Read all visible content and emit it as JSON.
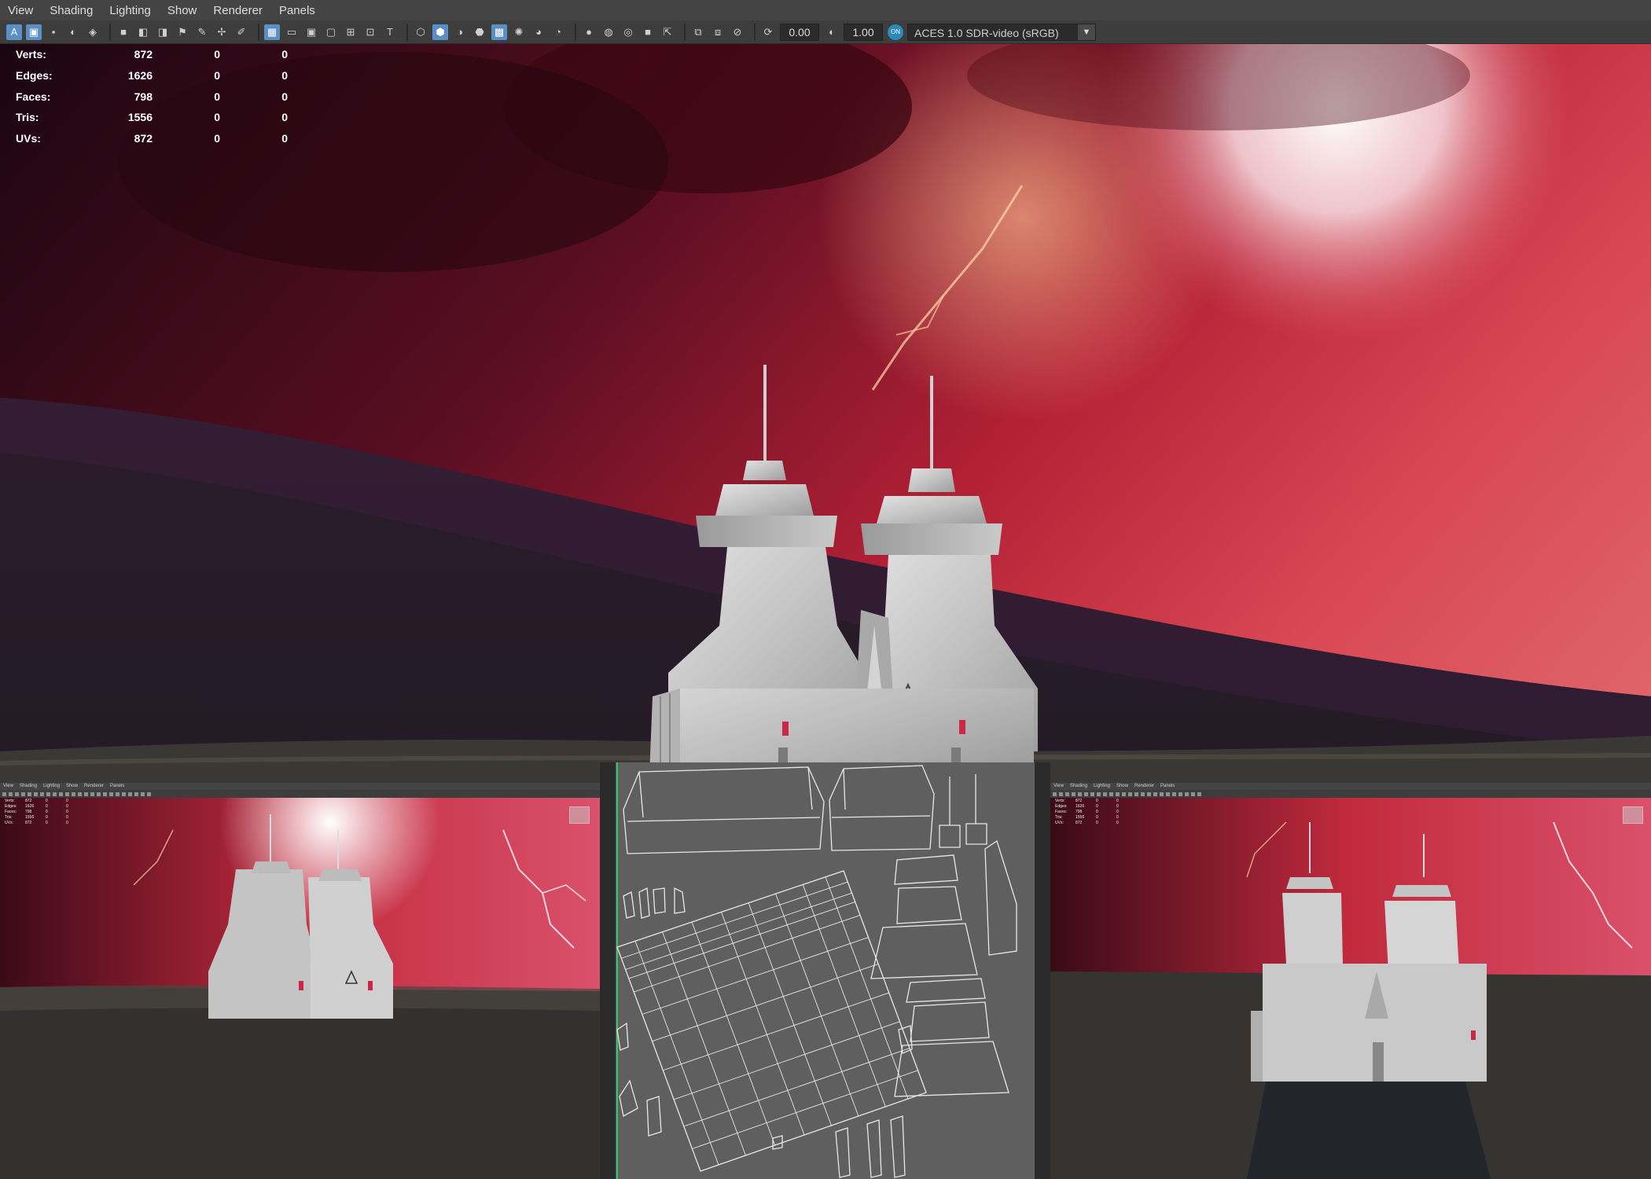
{
  "menu": [
    "View",
    "Shading",
    "Lighting",
    "Show",
    "Renderer",
    "Panels"
  ],
  "toolbar": {
    "exposure": "0.00",
    "gamma": "1.00",
    "color_space": "ACES 1.0 SDR-video (sRGB)",
    "icons": [
      "select-camera-icon",
      "camera-attributes-icon",
      "bookmark-icon",
      "image-plane-icon",
      "wireframe-icon",
      "smooth-shade-icon",
      "default-material-icon",
      "textured-icon",
      "use-lights-icon",
      "shadows-icon",
      "screen-space-ao-icon",
      "motion-blur-icon",
      "multisample-aa-icon",
      "depth-of-field-icon",
      "isolate-select-icon",
      "xray-icon",
      "xray-joints-icon",
      "backface-culling-icon",
      "grid-icon",
      "film-gate-icon",
      "resolution-gate-icon",
      "gate-mask-icon",
      "field-chart-icon",
      "safe-action-icon",
      "safe-title-icon"
    ]
  },
  "hud": {
    "rows": [
      {
        "label": "Verts:",
        "a": "872",
        "b": "0",
        "c": "0"
      },
      {
        "label": "Edges:",
        "a": "1626",
        "b": "0",
        "c": "0"
      },
      {
        "label": "Faces:",
        "a": "798",
        "b": "0",
        "c": "0"
      },
      {
        "label": "Tris:",
        "a": "1556",
        "b": "0",
        "c": "0"
      },
      {
        "label": "UVs:",
        "a": "872",
        "b": "0",
        "c": "0"
      }
    ]
  },
  "colors": {
    "sky_red": "#c8283a",
    "sky_dark": "#2a0a14",
    "ground": "#3a3834",
    "stone": "#c9c9c9",
    "uv_bg": "#5f5f5f",
    "menu_bg": "#444444"
  }
}
